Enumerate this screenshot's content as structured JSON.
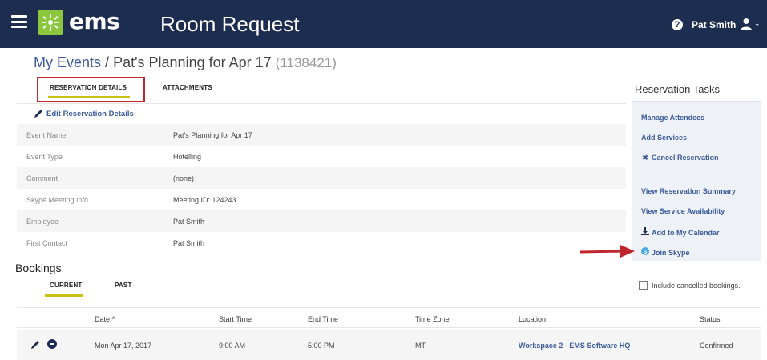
{
  "header": {
    "logo_text": "ems",
    "app_title": "Room Request",
    "user_name": "Pat Smith",
    "help_glyph": "?"
  },
  "breadcrumb": {
    "root": "My Events",
    "separator": "/",
    "event_name": "Pat's Planning for Apr 17",
    "event_id": "(1138421)"
  },
  "tabs": {
    "reservation_details": "RESERVATION DETAILS",
    "attachments": "ATTACHMENTS"
  },
  "details": {
    "edit_label": "Edit Reservation Details",
    "rows": [
      {
        "label": "Event Name",
        "value": "Pat's Planning for Apr 17"
      },
      {
        "label": "Event Type",
        "value": "Hotelling"
      },
      {
        "label": "Comment",
        "value": "(none)"
      },
      {
        "label": "Skype Meeting Info",
        "value": "Meeting ID: 124243"
      },
      {
        "label": "Employee",
        "value": "Pat Smith"
      },
      {
        "label": "First Contact",
        "value": "Pat Smith"
      }
    ]
  },
  "tasks": {
    "title": "Reservation Tasks",
    "items": [
      {
        "label": "Manage Attendees",
        "icon": ""
      },
      {
        "label": "Add Services",
        "icon": ""
      },
      {
        "label": "Cancel Reservation",
        "icon": "close-icon"
      },
      {
        "label": "View Reservation Summary",
        "icon": ""
      },
      {
        "label": "View Service Availability",
        "icon": ""
      },
      {
        "label": "Add to My Calendar",
        "icon": "download-icon"
      },
      {
        "label": "Join Skype",
        "icon": "skype-icon"
      }
    ]
  },
  "bookings": {
    "title": "Bookings",
    "tabs": {
      "current": "CURRENT",
      "past": "PAST"
    },
    "include_cancelled_label": "Include cancelled bookings.",
    "include_cancelled_checked": false,
    "columns": {
      "date": "Date ^",
      "start": "Start Time",
      "end": "End Time",
      "tz": "Time Zone",
      "location": "Location",
      "status": "Status"
    },
    "rows": [
      {
        "date": "Mon Apr 17, 2017",
        "start": "9:00 AM",
        "end": "5:00 PM",
        "tz": "MT",
        "location": "Workspace 2 - EMS Software HQ",
        "status": "Confirmed"
      }
    ]
  },
  "colors": {
    "navbar": "#1d2d4f",
    "logo_green": "#8cc63f",
    "link": "#3a5a9b",
    "tab_underline": "#c8c012",
    "annotation_red": "#c0262e"
  }
}
